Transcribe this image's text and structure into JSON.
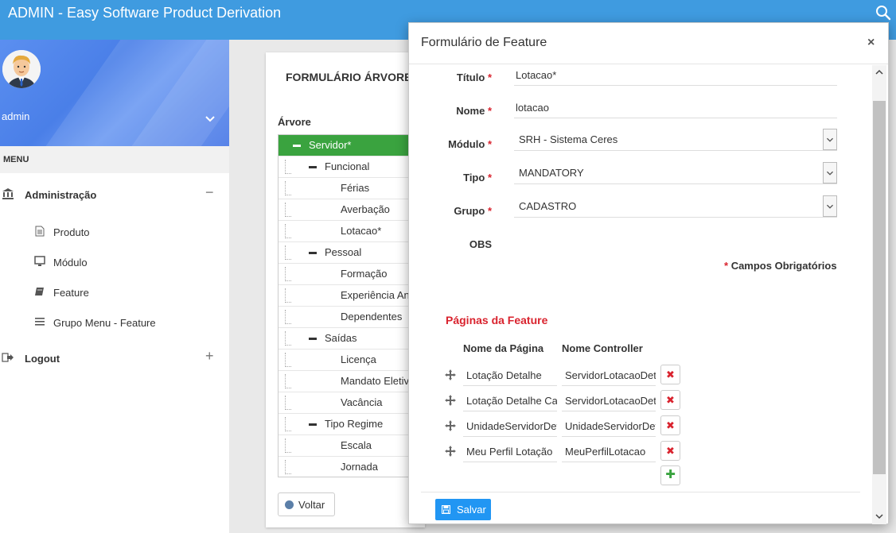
{
  "app": {
    "title": "ADMIN - Easy Software Product Derivation"
  },
  "sidebar": {
    "username": "admin",
    "menu_header": "MENU",
    "groups": [
      {
        "label": "Administração",
        "sign": "−",
        "items": [
          {
            "label": "Produto",
            "icon": "document-icon"
          },
          {
            "label": "Módulo",
            "icon": "monitor-icon"
          },
          {
            "label": "Feature",
            "icon": "book-icon"
          },
          {
            "label": "Grupo Menu - Feature",
            "icon": "list-icon"
          }
        ]
      },
      {
        "label": "Logout",
        "sign": "+"
      }
    ]
  },
  "background_panel": {
    "title": "FORMULÁRIO ÁRVORE",
    "tree_label": "Árvore",
    "tree": [
      {
        "label": "Servidor*",
        "level": 0
      },
      {
        "label": "Funcional",
        "level": 1
      },
      {
        "label": "Férias",
        "level": 2
      },
      {
        "label": "Averbação",
        "level": 2
      },
      {
        "label": "Lotacao*",
        "level": 2
      },
      {
        "label": "Pessoal",
        "level": 1
      },
      {
        "label": "Formação",
        "level": 2
      },
      {
        "label": "Experiência Anterior",
        "level": 2
      },
      {
        "label": "Dependentes",
        "level": 2
      },
      {
        "label": "Saídas",
        "level": 1
      },
      {
        "label": "Licença",
        "level": 2
      },
      {
        "label": "Mandato Eletivo",
        "level": 2
      },
      {
        "label": "Vacância",
        "level": 2
      },
      {
        "label": "Tipo Regime",
        "level": 1
      },
      {
        "label": "Escala",
        "level": 2
      },
      {
        "label": "Jornada",
        "level": 2
      }
    ],
    "back_label": "Voltar"
  },
  "modal": {
    "title": "Formulário de Feature",
    "close": "×",
    "fields": {
      "titulo": {
        "label": "Título",
        "value": "Lotacao*"
      },
      "nome": {
        "label": "Nome",
        "value": "lotacao"
      },
      "modulo": {
        "label": "Módulo",
        "value": "SRH - Sistema Ceres"
      },
      "tipo": {
        "label": "Tipo",
        "value": "MANDATORY"
      },
      "grupo": {
        "label": "Grupo",
        "value": "CADASTRO"
      },
      "obs": {
        "label": "OBS"
      }
    },
    "required_mark": "*",
    "required_note": "Campos Obrigatórios",
    "pages_section": {
      "title": "Páginas da Feature",
      "col_page": "Nome da Página",
      "col_controller": "Nome Controller",
      "rows": [
        {
          "page": "Lotação Detalhe",
          "controller": "ServidorLotacaoDetalhe"
        },
        {
          "page": "Lotação Detalhe Cadastro",
          "controller": "ServidorLotacaoDetalhe"
        },
        {
          "page": "UnidadeServidorDetalhe",
          "controller": "UnidadeServidorDetalhe"
        },
        {
          "page": "Meu Perfil Lotação",
          "controller": "MeuPerfilLotacao"
        }
      ]
    },
    "save_label": "Salvar"
  },
  "colors": {
    "topbar": "#3f9be0",
    "tree_selected": "#3aa33f",
    "required": "#d9232e",
    "save": "#2196f3"
  }
}
